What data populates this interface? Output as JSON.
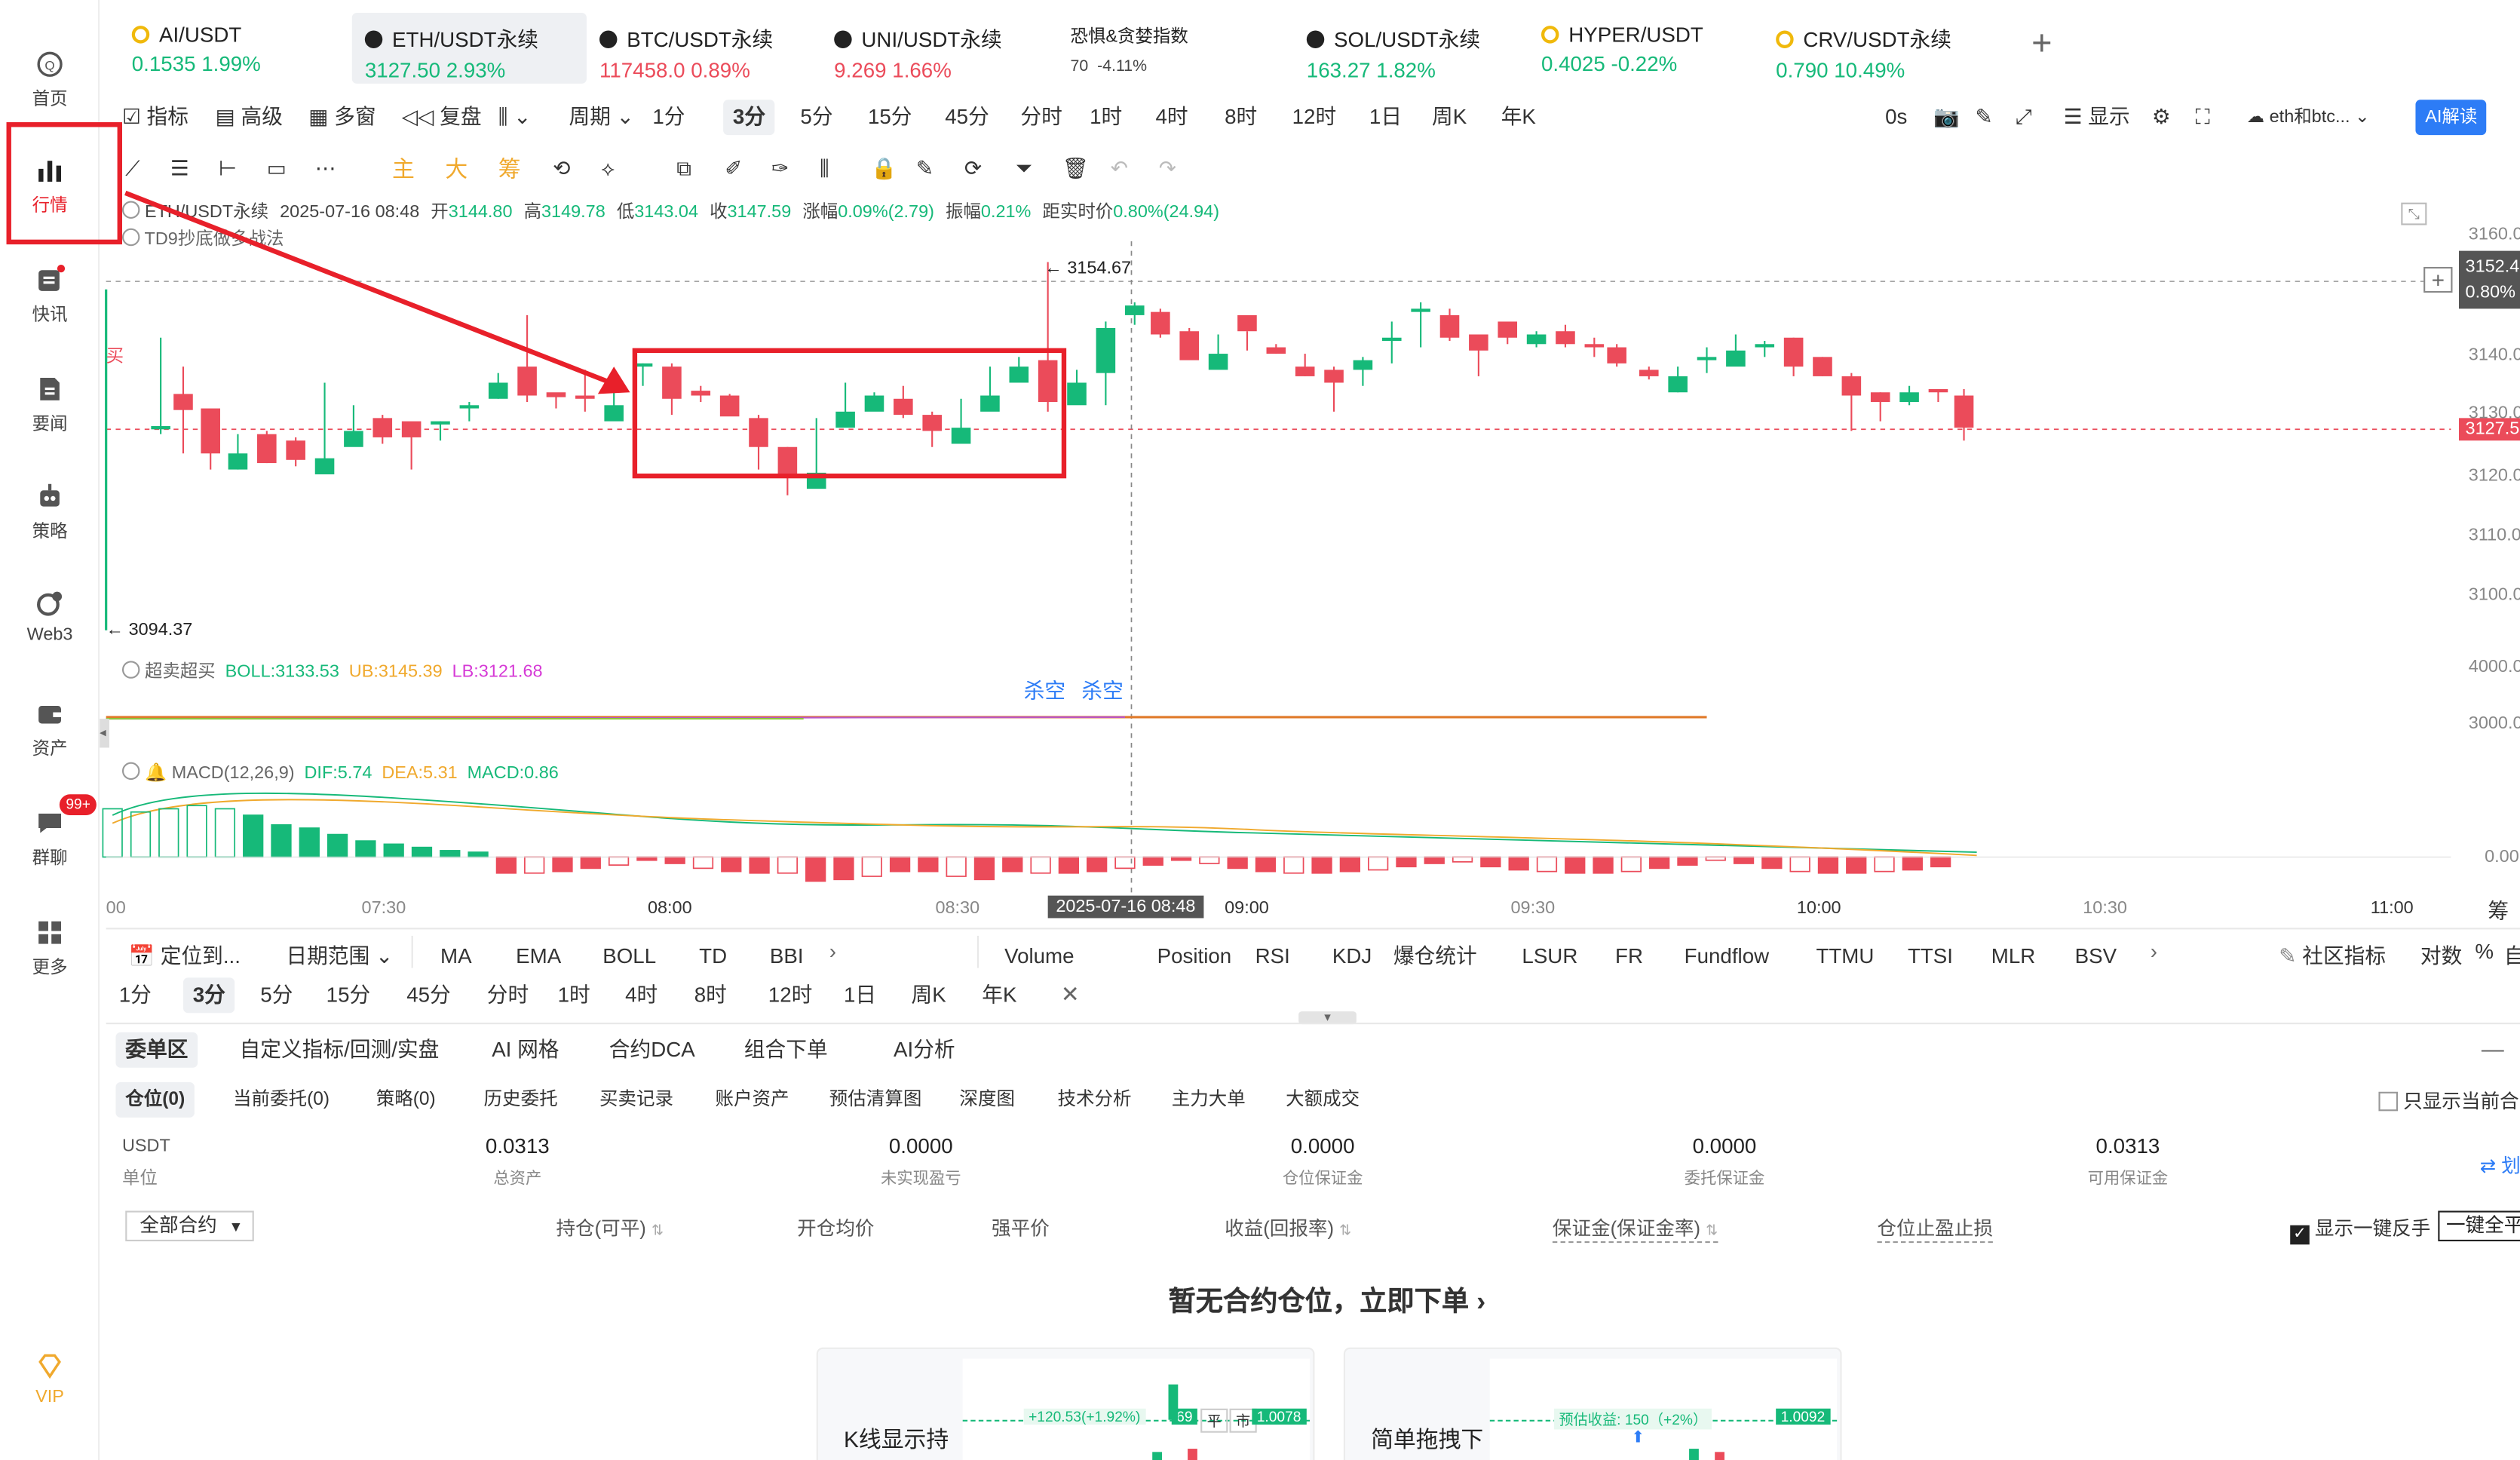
{
  "sidebar": {
    "items": [
      {
        "label": "首页",
        "icon": "home-icon"
      },
      {
        "label": "行情",
        "icon": "chart-bar-icon"
      },
      {
        "label": "快讯",
        "icon": "news-flash-icon"
      },
      {
        "label": "要闻",
        "icon": "document-icon"
      },
      {
        "label": "策略",
        "icon": "robot-icon"
      },
      {
        "label": "Web3",
        "icon": "web3-icon"
      },
      {
        "label": "资产",
        "icon": "wallet-icon"
      },
      {
        "label": "群聊",
        "icon": "chat-icon"
      },
      {
        "label": "更多",
        "icon": "grid-icon"
      }
    ],
    "chat_badge": "99+",
    "vip_label": "VIP"
  },
  "tickers": [
    {
      "name": "AI/USDT",
      "price": "0.1535",
      "change": "1.99%",
      "dir": "up",
      "coin_color": "#f0b90b"
    },
    {
      "name": "ETH/USDT永续",
      "price": "3127.50",
      "change": "2.93%",
      "dir": "up",
      "coin_color": "#222"
    },
    {
      "name": "BTC/USDT永续",
      "price": "117458.0",
      "change": "0.89%",
      "dir": "down",
      "coin_color": "#222"
    },
    {
      "name": "UNI/USDT永续",
      "price": "9.269",
      "change": "1.66%",
      "dir": "down",
      "coin_color": "#222"
    },
    {
      "name": "恐惧&贪婪指数",
      "price": "70",
      "change": "-4.11%",
      "dir": "neutral",
      "coin_color": ""
    },
    {
      "name": "SOL/USDT永续",
      "price": "163.27",
      "change": "1.82%",
      "dir": "up",
      "coin_color": "#222"
    },
    {
      "name": "HYPER/USDT",
      "price": "0.4025",
      "change": "-0.22%",
      "dir": "up",
      "coin_color": "#f0b90b"
    },
    {
      "name": "CRV/USDT永续",
      "price": "0.790",
      "change": "10.49%",
      "dir": "up",
      "coin_color": "#f0b90b"
    }
  ],
  "toolbar": {
    "left": [
      "指标",
      "高级",
      "多窗",
      "复盘",
      "",
      "周期"
    ],
    "periods": [
      "1分",
      "3分",
      "5分",
      "15分",
      "45分",
      "分时",
      "1时",
      "4时",
      "8时",
      "12时",
      "1日",
      "周K",
      "年K"
    ],
    "selected_period": "3分",
    "right_time": "0s",
    "display_label": "显示",
    "compare_label": "eth和btc...",
    "ai_label": "AI解读"
  },
  "drawbar": {
    "labels": [
      "主",
      "大",
      "筹"
    ]
  },
  "chart_info": {
    "symbol": "ETH/USDT永续",
    "datetime": "2025-07-16 08:48",
    "open_label": "开",
    "open": "3144.80",
    "high_label": "高",
    "high": "3149.78",
    "low_label": "低",
    "low": "3143.04",
    "close_label": "收",
    "close": "3147.59",
    "chg_label": "涨幅",
    "chg": "0.09%(2.79)",
    "amp_label": "振幅",
    "amp": "0.21%",
    "dist_label": "距实时价",
    "dist": "0.80%(24.94)",
    "indicator": "TD9抄底做多战法",
    "high_mark": "3154.67",
    "low_mark": "3094.37",
    "buy_mark": "买",
    "cursor_time": "2025-07-16 08:48"
  },
  "price_axis": [
    "3160.0",
    "3152.4",
    "0.80%",
    "3140.0",
    "3130.0",
    "3127.5",
    "3120.0",
    "3110.0",
    "3100.0"
  ],
  "boll": {
    "name": "超卖超买",
    "boll": "BOLL:3133.53",
    "ub": "UB:3145.39",
    "lb": "LB:3121.68",
    "sell_labels": [
      "杀空",
      "杀空"
    ],
    "axis": [
      "4000.0",
      "3000.0"
    ]
  },
  "macd": {
    "name": "MACD(12,26,9)",
    "dif": "DIF:5.74",
    "dea": "DEA:5.31",
    "macd": "MACD:0.86",
    "axis": "0.00"
  },
  "time_axis": [
    "00",
    "07:30",
    "08:00",
    "08:30",
    "09:00",
    "09:30",
    "10:00",
    "10:30",
    "11:00"
  ],
  "time_axis_last": "筹",
  "indicator_bar": {
    "left": [
      "定位到...",
      "日期范围"
    ],
    "main": [
      "MA",
      "EMA",
      "BOLL",
      "TD",
      "BBI"
    ],
    "sub": [
      "Volume",
      "Position",
      "RSI",
      "KDJ",
      "爆仓统计",
      "LSUR",
      "FR",
      "Fundflow",
      "TTMU",
      "TTSI",
      "MLR",
      "BSV"
    ],
    "right": [
      "社区指标",
      "对数",
      "%",
      "自"
    ]
  },
  "period_bar": {
    "items": [
      "1分",
      "3分",
      "5分",
      "15分",
      "45分",
      "分时",
      "1时",
      "4时",
      "8时",
      "12时",
      "1日",
      "周K",
      "年K"
    ],
    "selected": "3分"
  },
  "order_tabs": [
    "委单区",
    "自定义指标/回测/实盘",
    "AI 网格",
    "合约DCA",
    "组合下单",
    "AI分析"
  ],
  "sub_tabs": [
    "仓位(0)",
    "当前委托(0)",
    "策略(0)",
    "历史委托",
    "买卖记录",
    "账户资产",
    "预估清算图",
    "深度图",
    "技术分析",
    "主力大单",
    "大额成交"
  ],
  "only_current_label": "只显示当前合",
  "account": {
    "unit_currency": "USDT",
    "unit_label": "单位",
    "stats": [
      {
        "value": "0.0313",
        "label": "总资产"
      },
      {
        "value": "0.0000",
        "label": "未实现盈亏"
      },
      {
        "value": "0.0000",
        "label": "仓位保证金"
      },
      {
        "value": "0.0000",
        "label": "委托保证金"
      },
      {
        "value": "0.0313",
        "label": "可用保证金"
      }
    ],
    "transfer_label": "⇄ 划"
  },
  "position_header": {
    "filter": "全部合约",
    "cols": [
      "持仓(可平)",
      "开仓均价",
      "强平价",
      "收益(回报率)",
      "保证金(保证金率)",
      "仓位止盈止损"
    ],
    "reverse_label": "显示一键反手",
    "close_all_label": "一键全平"
  },
  "empty_state": "暂无合约仓位，立即下单",
  "promo_cards": [
    {
      "title": "K线显示持仓情况",
      "tag1": "+120.53(+1.92%)",
      "tag2": "69",
      "tag3": "平",
      "tag4": "市",
      "price": "1.0078"
    },
    {
      "title": "简单拖拽下单止盈",
      "tag1": "预估收益: 150（+2%）",
      "price": "1.0092"
    }
  ],
  "colors": {
    "up": "#16b979",
    "down": "#eb4b5a",
    "accent": "#f0a92d",
    "annotation": "#e8202a",
    "ai": "#2d7cf6"
  }
}
